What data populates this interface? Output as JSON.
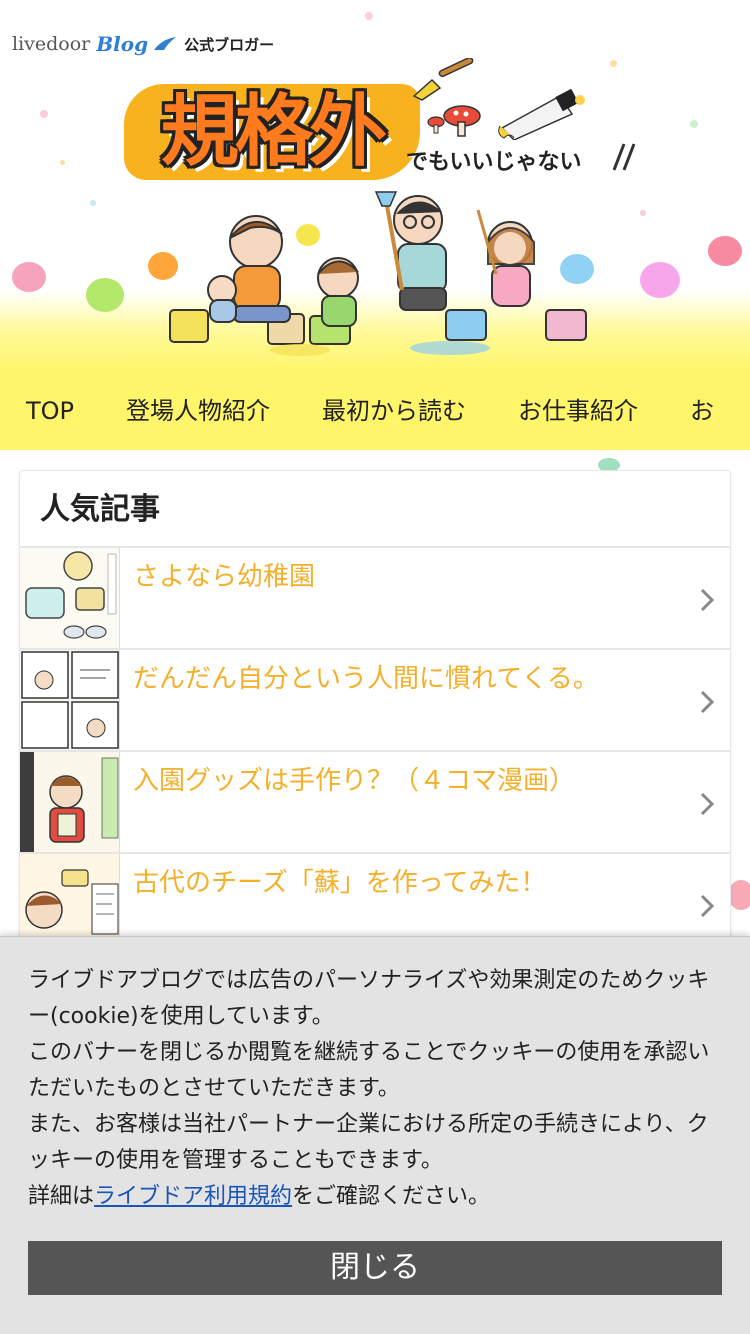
{
  "header": {
    "livedoor_brand": "livedoor",
    "blog_brand": "Blog",
    "official_label": "公式ブロガー",
    "blog_title": "規格外",
    "blog_subtitle": "でもいいじゃない"
  },
  "nav": {
    "items": [
      {
        "label": "TOP"
      },
      {
        "label": "登場人物紹介"
      },
      {
        "label": "最初から読む"
      },
      {
        "label": "お仕事紹介"
      },
      {
        "label": "お"
      }
    ]
  },
  "popular": {
    "heading": "人気記事",
    "articles": [
      {
        "title": "さよなら幼稚園"
      },
      {
        "title": "だんだん自分という人間に慣れてくる。"
      },
      {
        "title": "入園グッズは手作り？（４コマ漫画）"
      },
      {
        "title": "古代のチーズ「蘇」を作ってみた！"
      }
    ]
  },
  "cookie": {
    "line1": "ライブドアブログでは広告のパーソナライズや効果測定のためクッキー(cookie)を使用しています。",
    "line2": "このバナーを閉じるか閲覧を継続することでクッキーの使用を承認いただいたものとさせていただきます。",
    "line3": "また、お客様は当社パートナー企業における所定の手続きにより、クッキーの使用を管理することもできます。",
    "detail_prefix": "詳細は",
    "detail_link": "ライブドア利用規約",
    "detail_suffix": "をご確認ください。",
    "close_label": "閉じる"
  },
  "colors": {
    "nav_bg": "#fff56a",
    "article_title": "#f4b02a",
    "close_button": "#555555",
    "link": "#1a56b7"
  }
}
